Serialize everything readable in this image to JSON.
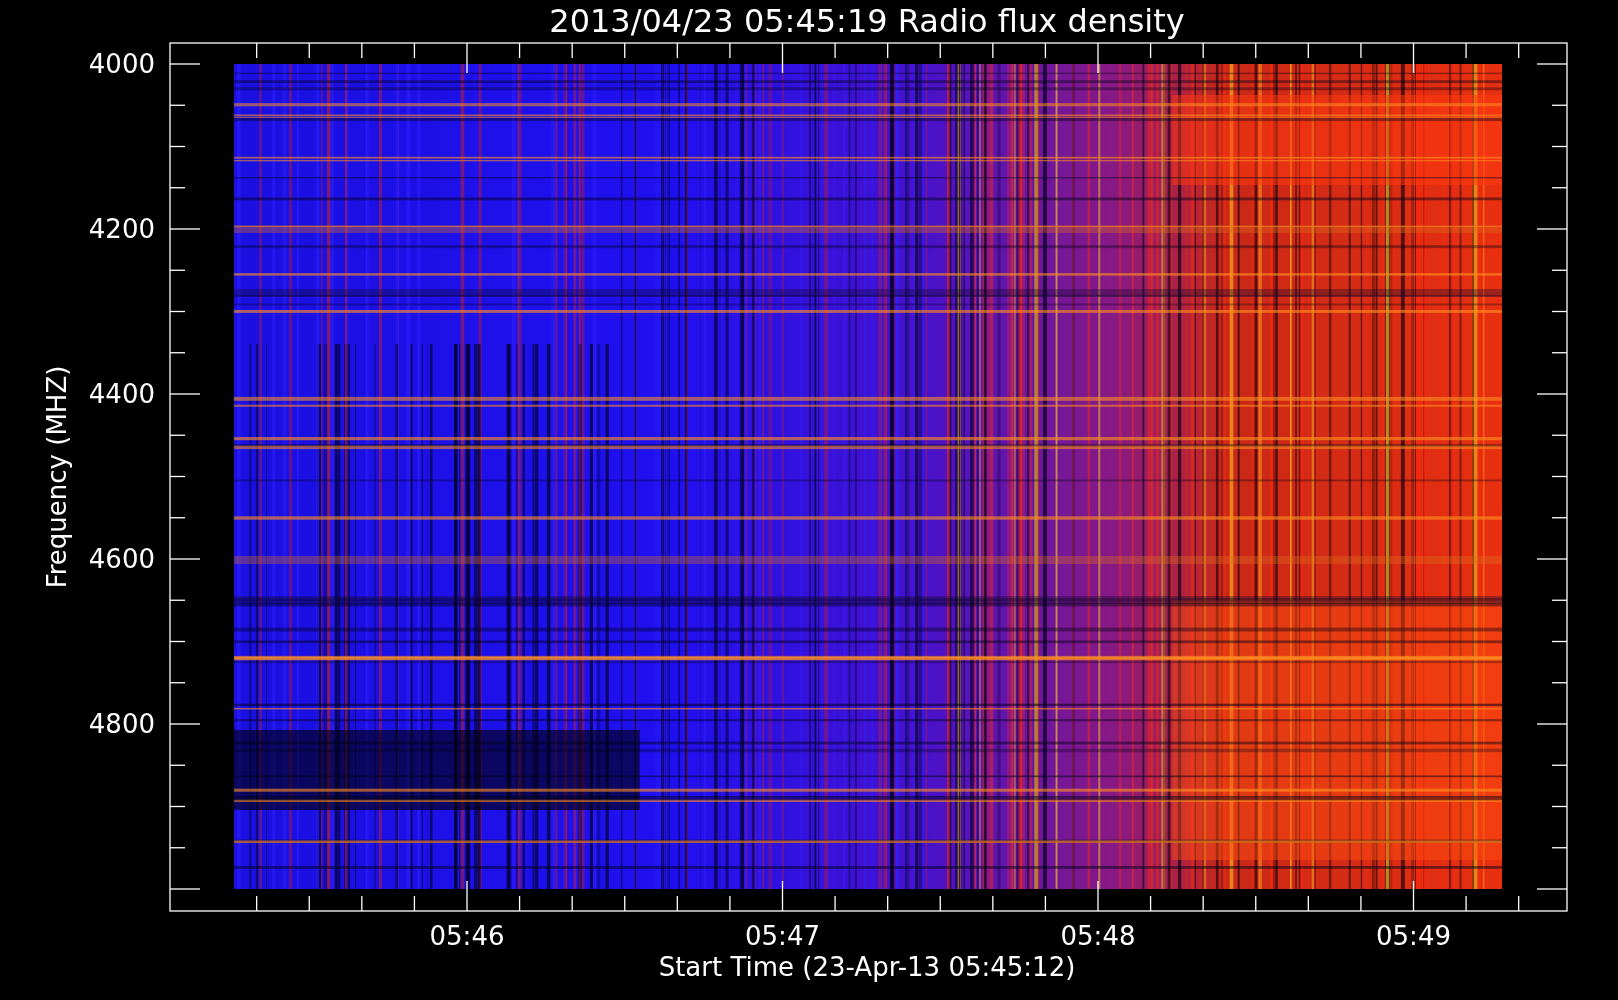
{
  "plot": {
    "title": "2013/04/23 05:45:19 Radio flux density",
    "y_axis": {
      "label": "Frequency (MHZ)",
      "ticks": [
        "4000",
        "4200",
        "4400",
        "4600",
        "4800"
      ]
    },
    "x_axis": {
      "label": "Start Time (23-Apr-13 05:45:12)",
      "ticks": [
        "05:46",
        "05:47",
        "05:48",
        "05:49"
      ]
    }
  }
}
